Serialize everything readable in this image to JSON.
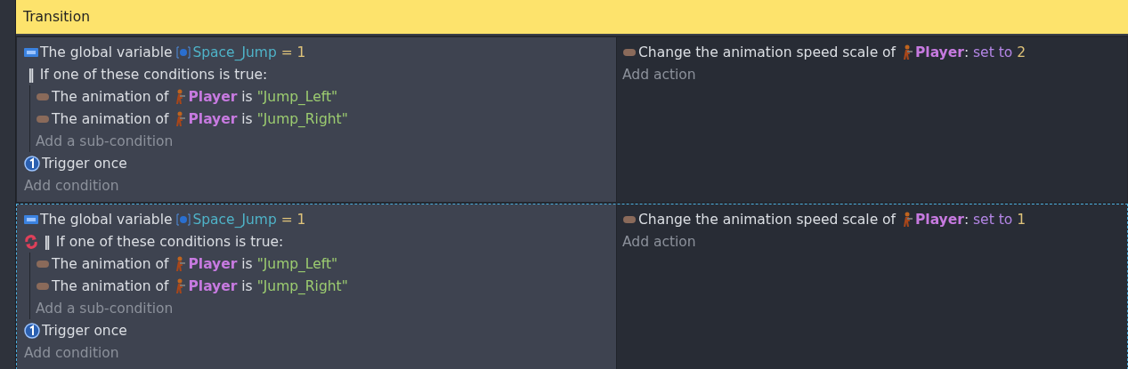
{
  "group": {
    "title": "Transition"
  },
  "events": [
    {
      "selected": false,
      "conditions": [
        {
          "kind": "variable",
          "parts": [
            {
              "kind": "text",
              "s": "The global variable "
            },
            {
              "kind": "variable",
              "s": "Space_Jump"
            },
            {
              "kind": "value",
              "s": " = 1"
            }
          ]
        },
        {
          "kind": "or",
          "loop": false,
          "marker": "‖",
          "title": "If one of these conditions is true:",
          "add_sub": "Add a sub-condition",
          "children": [
            {
              "kind": "object",
              "parts": [
                {
                  "kind": "text",
                  "s": "The animation of "
                },
                {
                  "kind": "object",
                  "s": "Player"
                },
                {
                  "kind": "text",
                  "s": " is "
                },
                {
                  "kind": "string",
                  "s": "\"Jump_Left\""
                }
              ]
            },
            {
              "kind": "object",
              "parts": [
                {
                  "kind": "text",
                  "s": "The animation of "
                },
                {
                  "kind": "object",
                  "s": "Player"
                },
                {
                  "kind": "text",
                  "s": " is "
                },
                {
                  "kind": "string",
                  "s": "\"Jump_Right\""
                }
              ]
            }
          ]
        },
        {
          "kind": "trigger",
          "parts": [
            {
              "kind": "text",
              "s": "Trigger once"
            }
          ]
        }
      ],
      "add_condition": "Add condition",
      "actions": [
        {
          "kind": "object",
          "parts": [
            {
              "kind": "text",
              "s": "Change the animation speed scale of "
            },
            {
              "kind": "object",
              "s": "Player"
            },
            {
              "kind": "text",
              "s": ": "
            },
            {
              "kind": "parameter",
              "s": "set to"
            },
            {
              "kind": "value",
              "s": " 2"
            }
          ]
        }
      ],
      "add_action": "Add action"
    },
    {
      "selected": true,
      "conditions": [
        {
          "kind": "variable",
          "parts": [
            {
              "kind": "text",
              "s": "The global variable "
            },
            {
              "kind": "variable",
              "s": "Space_Jump"
            },
            {
              "kind": "value",
              "s": " = 1"
            }
          ]
        },
        {
          "kind": "or",
          "loop": true,
          "marker": "‖",
          "title": "If one of these conditions is true:",
          "add_sub": "Add a sub-condition",
          "children": [
            {
              "kind": "object",
              "parts": [
                {
                  "kind": "text",
                  "s": "The animation of "
                },
                {
                  "kind": "object",
                  "s": "Player"
                },
                {
                  "kind": "text",
                  "s": " is "
                },
                {
                  "kind": "string",
                  "s": "\"Jump_Left\""
                }
              ]
            },
            {
              "kind": "object",
              "parts": [
                {
                  "kind": "text",
                  "s": "The animation of "
                },
                {
                  "kind": "object",
                  "s": "Player"
                },
                {
                  "kind": "text",
                  "s": " is "
                },
                {
                  "kind": "string",
                  "s": "\"Jump_Right\""
                }
              ]
            }
          ]
        },
        {
          "kind": "trigger",
          "parts": [
            {
              "kind": "text",
              "s": "Trigger once"
            }
          ]
        }
      ],
      "add_condition": "Add condition",
      "actions": [
        {
          "kind": "object",
          "parts": [
            {
              "kind": "text",
              "s": "Change the animation speed scale of "
            },
            {
              "kind": "object",
              "s": "Player"
            },
            {
              "kind": "text",
              "s": ": "
            },
            {
              "kind": "parameter",
              "s": "set to"
            },
            {
              "kind": "value",
              "s": " 1"
            }
          ]
        }
      ],
      "add_action": "Add action"
    }
  ]
}
